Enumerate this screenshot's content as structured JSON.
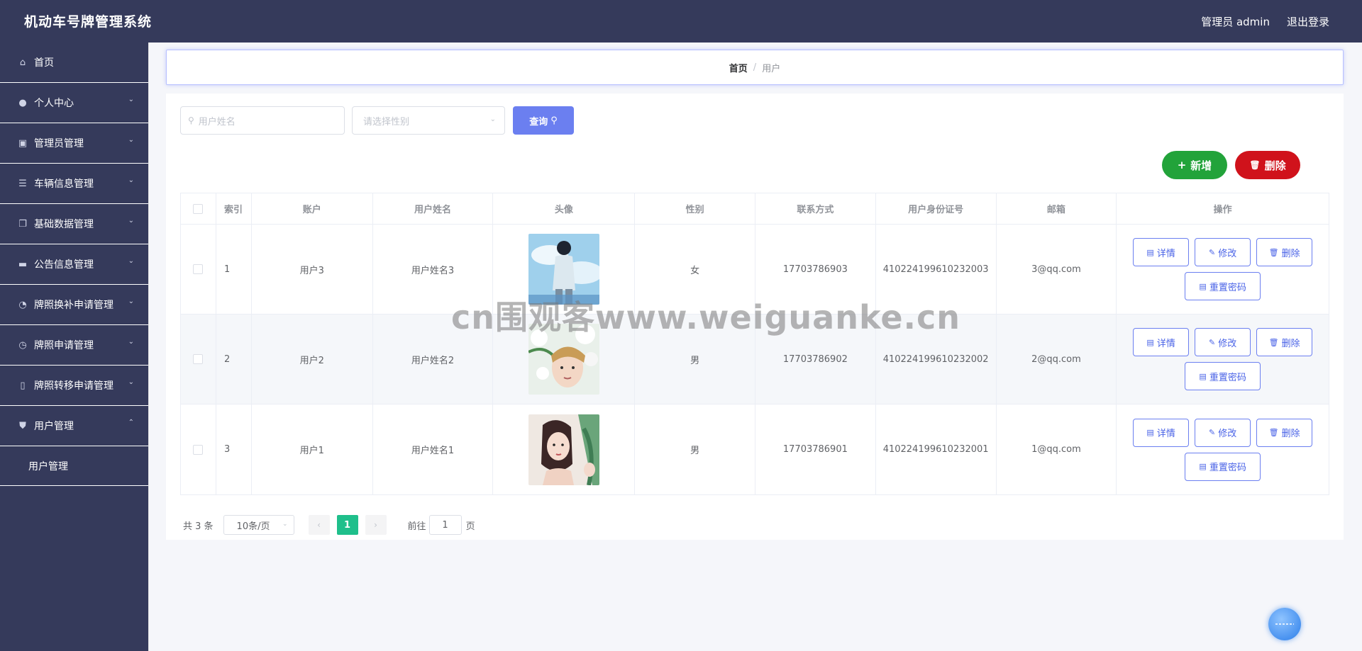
{
  "header": {
    "title": "机动车号牌管理系统",
    "user_label": "管理员 admin",
    "logout": "退出登录"
  },
  "sidebar": {
    "items": [
      {
        "label": "首页",
        "icon": "home-icon",
        "glyph": "⌂",
        "chevron": ""
      },
      {
        "label": "个人中心",
        "icon": "user-icon",
        "glyph": "●",
        "chevron": "⌄"
      },
      {
        "label": "管理员管理",
        "icon": "chart-icon",
        "glyph": "▣",
        "chevron": "⌄"
      },
      {
        "label": "车辆信息管理",
        "icon": "list-icon",
        "glyph": "☰",
        "chevron": "⌄"
      },
      {
        "label": "基础数据管理",
        "icon": "copy-icon",
        "glyph": "❐",
        "chevron": "⌄"
      },
      {
        "label": "公告信息管理",
        "icon": "monitor-icon",
        "glyph": "▬",
        "chevron": "⌄"
      },
      {
        "label": "牌照换补申请管理",
        "icon": "gauge-icon",
        "glyph": "◔",
        "chevron": "⌄"
      },
      {
        "label": "牌照申请管理",
        "icon": "clock-icon",
        "glyph": "◷",
        "chevron": "⌄"
      },
      {
        "label": "牌照转移申请管理",
        "icon": "phone-icon",
        "glyph": "▯",
        "chevron": "⌄"
      },
      {
        "label": "用户管理",
        "icon": "stamp-icon",
        "glyph": "⛊",
        "chevron": "⌃"
      }
    ],
    "subitems": [
      {
        "label": "用户管理"
      }
    ]
  },
  "breadcrumb": {
    "home": "首页",
    "separator": "/",
    "current": "用户"
  },
  "search": {
    "name_placeholder": "用户姓名",
    "gender_placeholder": "请选择性别",
    "query_label": "查询",
    "search_glyph": "⚲",
    "chevron_glyph": "⌄"
  },
  "actions": {
    "add": "新增",
    "delete": "删除",
    "add_glyph": "+",
    "delete_glyph": "🗑"
  },
  "table": {
    "headers": [
      "",
      "索引",
      "账户",
      "用户姓名",
      "头像",
      "性别",
      "联系方式",
      "用户身份证号",
      "邮箱",
      "操作"
    ],
    "ops": {
      "detail": "详情",
      "edit": "修改",
      "delete": "删除",
      "reset": "重置密码"
    },
    "rows": [
      {
        "index": "1",
        "account": "用户3",
        "name": "用户姓名3",
        "gender": "女",
        "phone": "17703786903",
        "idcard": "410224199610232003",
        "email": "3@qq.com",
        "avatar": "avatar-boy-sky"
      },
      {
        "index": "2",
        "account": "用户2",
        "name": "用户姓名2",
        "gender": "男",
        "phone": "17703786902",
        "idcard": "410224199610232002",
        "email": "2@qq.com",
        "avatar": "avatar-flowers"
      },
      {
        "index": "3",
        "account": "用户1",
        "name": "用户姓名1",
        "gender": "男",
        "phone": "17703786901",
        "idcard": "410224199610232001",
        "email": "1@qq.com",
        "avatar": "avatar-girl-painting"
      }
    ]
  },
  "pagination": {
    "total": "共 3 条",
    "page_size": "10条/页",
    "current_page": "1",
    "goto_label": "前往",
    "goto_value": "1",
    "page_unit": "页",
    "prev": "‹",
    "next": "›"
  },
  "watermark": "cn围观客www.weiguanke.cn",
  "colors": {
    "sidebar_bg": "#353a5b",
    "primary": "#6b7ff0",
    "success": "#22a33a",
    "danger": "#d0121b",
    "page_active": "#1fbf8b"
  }
}
